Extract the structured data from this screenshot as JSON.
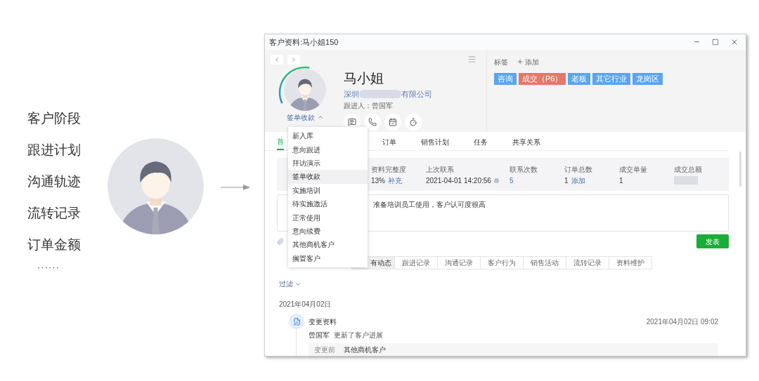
{
  "left_panel": {
    "features": [
      "客户阶段",
      "跟进计划",
      "沟通轨迹",
      "流转记录",
      "订单金额"
    ],
    "ellipsis": "······"
  },
  "window": {
    "title": "客户资料:马小姐150"
  },
  "customer": {
    "name": "马小姐",
    "company_prefix": "深圳",
    "company_suffix": "有限公司",
    "follower": "跟进人：曾国军",
    "stage": "签单收款",
    "stage_menu_expanded": true
  },
  "tags_label": "标签",
  "add_tag": "添加",
  "tags": [
    {
      "label": "咨询",
      "color": "#5ba5ec"
    },
    {
      "label": "成交（P6）",
      "color": "#e5776b"
    },
    {
      "label": "老板",
      "color": "#5ba5ec"
    },
    {
      "label": "其它行业",
      "color": "#5ba5ec"
    },
    {
      "label": "龙岗区",
      "color": "#5ba5ec"
    }
  ],
  "stage_menu": [
    {
      "label": "新入库",
      "selected": false
    },
    {
      "label": "意向跟进",
      "selected": false
    },
    {
      "label": "拜访演示",
      "selected": false
    },
    {
      "label": "签单收款",
      "selected": true
    },
    {
      "label": "实施培训",
      "selected": false
    },
    {
      "label": "待实施激活",
      "selected": false
    },
    {
      "label": "正常使用",
      "selected": false
    },
    {
      "label": "意向续费",
      "selected": false
    },
    {
      "label": "其他商机客户",
      "selected": false
    },
    {
      "label": "搁置客户",
      "selected": false
    }
  ],
  "tabs": [
    {
      "label": "首",
      "selected": true
    },
    {
      "label": "订单",
      "selected": false
    },
    {
      "label": "销售计划",
      "selected": false
    },
    {
      "label": "任务",
      "selected": false
    },
    {
      "label": "共享关系",
      "selected": false
    }
  ],
  "stats": [
    {
      "label": "资料完整度",
      "value": "13%",
      "action": "补充"
    },
    {
      "label": "上次联系",
      "value": "2021-04-01 14:20:56",
      "kind": "info"
    },
    {
      "label": "联系次数",
      "value": "5"
    },
    {
      "label": "订单总数",
      "value": "1",
      "action": "添加"
    },
    {
      "label": "成交单量",
      "value": "1"
    },
    {
      "label": "成交总额",
      "kind": "hidden"
    }
  ],
  "note": "准备培训员工使用，客户认可度很高",
  "publish_button": "发表",
  "activity_tabs": [
    {
      "label": "有动态",
      "selected": true
    },
    {
      "label": "跟进记录",
      "selected": false
    },
    {
      "label": "沟通记录",
      "selected": false
    },
    {
      "label": "客户行为",
      "selected": false
    },
    {
      "label": "销售活动",
      "selected": false
    },
    {
      "label": "流转记录",
      "selected": false
    },
    {
      "label": "资料维护",
      "selected": false
    }
  ],
  "filter": "过滤",
  "timeline": {
    "date": "2021年04月02日",
    "entries": [
      {
        "title": "变更资料",
        "time": "2021年04月02日 09:02",
        "actor": "曾国军",
        "action": "更新了客户进展",
        "changes": [
          {
            "label": "变更前",
            "value": "其他商机客户"
          }
        ]
      }
    ]
  }
}
